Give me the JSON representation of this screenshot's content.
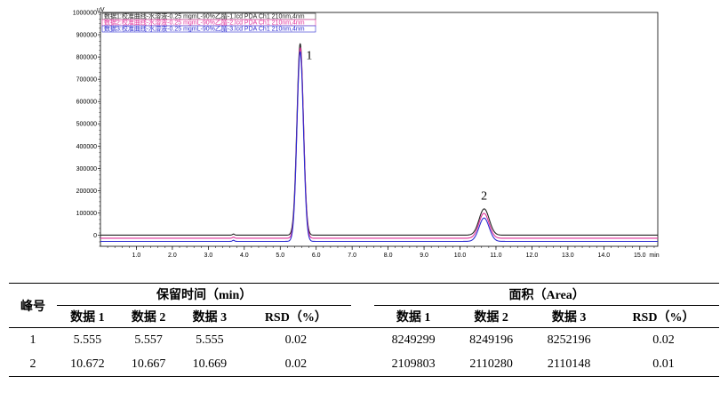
{
  "chart_data": {
    "type": "line",
    "xlabel": "min",
    "ylabel": "uV",
    "xlim": [
      0,
      15.5
    ],
    "ylim": [
      -50000,
      1000000
    ],
    "x_ticks": [
      "1.0",
      "2.0",
      "3.0",
      "4.0",
      "5.0",
      "6.0",
      "7.0",
      "8.0",
      "9.0",
      "10.0",
      "11.0",
      "12.0",
      "13.0",
      "14.0",
      "15.0"
    ],
    "y_ticks": [
      "1000000",
      "900000",
      "800000",
      "700000",
      "600000",
      "500000",
      "400000",
      "300000",
      "200000",
      "100000",
      "0"
    ],
    "legend": [
      "数据1:校准曲线-水溶液-0.25 mgmL-90%乙腈-1.lcd PDA Ch1 210nm,4nm",
      "数据2:校准曲线-水溶液-0.25 mgmL-90%乙腈-2.lcd PDA Ch1 210nm,4nm",
      "数据3:校准曲线-水溶液-0.25 mgmL-90%乙腈-3.lcd PDA Ch1 210nm,4nm"
    ],
    "peak_labels": [
      {
        "label": "1",
        "x": 5.56,
        "y": 790000
      },
      {
        "label": "2",
        "x": 10.67,
        "y": 160000
      }
    ],
    "series": [
      {
        "color": "#222222",
        "baseline": 0,
        "small_peak": {
          "x": 3.7,
          "height": 5000
        },
        "peaks": [
          {
            "x": 5.555,
            "height": 860000,
            "width": 0.09
          },
          {
            "x": 10.672,
            "height": 118000,
            "width": 0.14
          }
        ]
      },
      {
        "color": "#e0309a",
        "baseline": -14000,
        "small_peak": {
          "x": 3.7,
          "height": 5000
        },
        "peaks": [
          {
            "x": 5.557,
            "height": 855000,
            "width": 0.09
          },
          {
            "x": 10.667,
            "height": 112000,
            "width": 0.14
          }
        ]
      },
      {
        "color": "#2a2ad0",
        "baseline": -28000,
        "small_peak": {
          "x": 3.7,
          "height": 5000
        },
        "peaks": [
          {
            "x": 5.555,
            "height": 852000,
            "width": 0.09
          },
          {
            "x": 10.669,
            "height": 105000,
            "width": 0.14
          }
        ]
      }
    ]
  },
  "table": {
    "group1": "保留时间（min）",
    "group2": "面积（Area）",
    "peak_header": "峰号",
    "sub_headers": [
      "数据 1",
      "数据 2",
      "数据 3",
      "RSD（%）"
    ],
    "rows": [
      {
        "peak": "1",
        "rt": [
          "5.555",
          "5.557",
          "5.555",
          "0.02"
        ],
        "area": [
          "8249299",
          "8249196",
          "8252196",
          "0.02"
        ]
      },
      {
        "peak": "2",
        "rt": [
          "10.672",
          "10.667",
          "10.669",
          "0.02"
        ],
        "area": [
          "2109803",
          "2110280",
          "2110148",
          "0.01"
        ]
      }
    ]
  }
}
